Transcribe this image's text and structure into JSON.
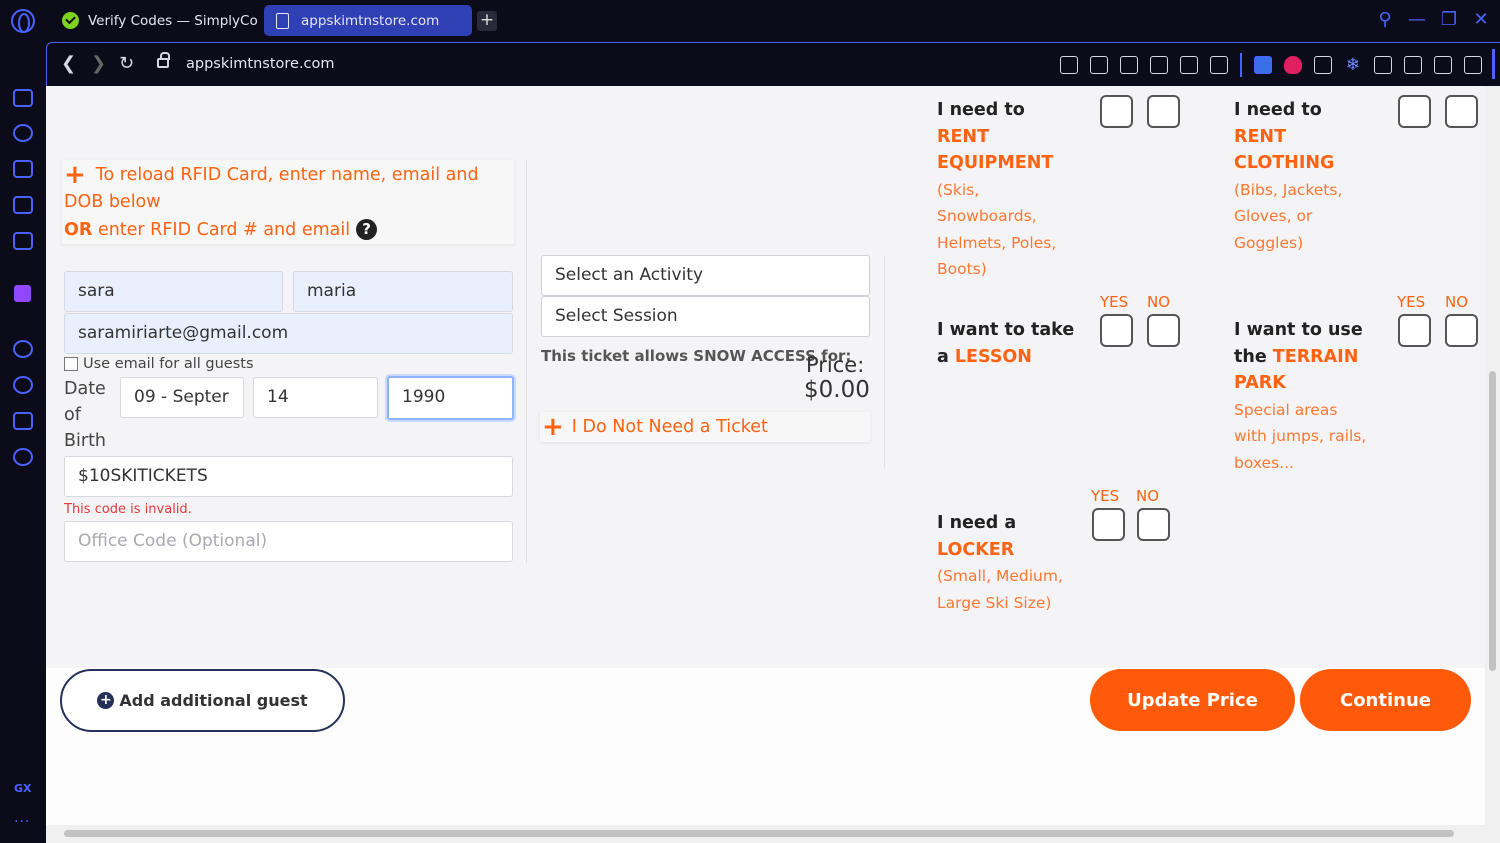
{
  "browser": {
    "tabs": [
      {
        "label": "Verify Codes — SimplyCo",
        "active": false
      },
      {
        "label": "appskimtnstore.com",
        "active": true
      }
    ],
    "new_tab_label": "+",
    "url": "appskimtnstore.com",
    "sidebar_bottom_label": "GX",
    "sidebar_more_label": "···"
  },
  "reload": {
    "line1": "To reload RFID Card, enter name, email and DOB below",
    "or_label": "OR",
    "line2": "enter RFID Card # and email",
    "help_glyph": "?"
  },
  "guest": {
    "first_name": "sara",
    "last_name": "maria",
    "email": "saramiriarte@gmail.com",
    "use_email_label": "Use email for all guests",
    "dob_label": "Date of Birth",
    "dob_month": "09 - Septer",
    "dob_day": "14",
    "dob_year": "1990",
    "promo_code": "$10SKITICKETS",
    "promo_error": "This code is invalid.",
    "office_code_placeholder": "Office Code (Optional)"
  },
  "ticket": {
    "activity_placeholder": "Select an Activity",
    "session_placeholder": "Select Session",
    "allows_text": "This ticket allows SNOW ACCESS for:",
    "price_label": "Price:",
    "price_value": "$0.00",
    "no_ticket_label": "I Do Not Need a Ticket"
  },
  "options": {
    "yes_label": "YES",
    "no_label": "NO",
    "rent_equipment": {
      "lead": "I need to",
      "highlight": "RENT EQUIPMENT",
      "detail": "(Skis, Snowboards, Helmets, Poles, Boots)"
    },
    "rent_clothing": {
      "lead": "I need to",
      "highlight": "RENT CLOTHING",
      "detail": "(Bibs, Jackets, Gloves, or Goggles)"
    },
    "lesson": {
      "lead": "I want to take a",
      "highlight": "LESSON"
    },
    "terrain_park": {
      "lead": "I want to use the",
      "highlight": "TERRAIN PARK",
      "detail": "Special areas with jumps, rails, boxes..."
    },
    "locker": {
      "lead": "I need a",
      "highlight": "LOCKER",
      "detail": "(Small, Medium, Large Ski Size)"
    }
  },
  "actions": {
    "add_guest_label": "Add additional guest",
    "update_price_label": "Update Price",
    "continue_label": "Continue"
  },
  "colors": {
    "accent": "#ff6210",
    "browser_accent": "#4a62ff",
    "active_tab": "#2f3fb4"
  }
}
